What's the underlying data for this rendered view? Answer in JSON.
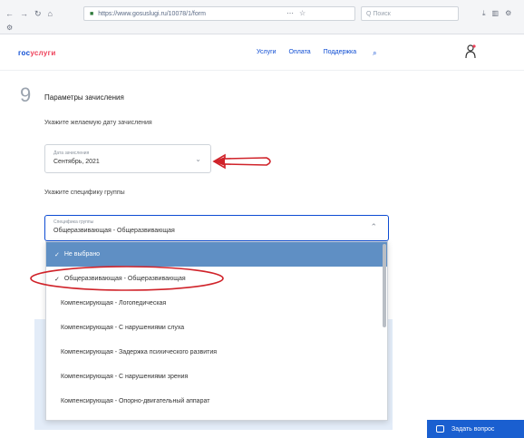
{
  "browser": {
    "nav_icons": [
      "back-icon",
      "forward-icon",
      "reload-icon",
      "home-icon"
    ],
    "url": "https://www.gosuslugi.ru/10078/1/form",
    "search_placeholder": "Q Поиск"
  },
  "header": {
    "logo_part1": "гос",
    "logo_part2": "услуги",
    "nav": [
      "Услуги",
      "Оплата",
      "Поддержка"
    ]
  },
  "step": {
    "number": "9",
    "title": "Параметры зачисления"
  },
  "date": {
    "label": "Укажите желаемую дату зачисления",
    "float_label": "Дата зачисления",
    "value": "Сентябрь, 2021"
  },
  "group": {
    "label": "Укажите специфику группы",
    "float_label": "Специфика группы",
    "value": "Общеразвивающая - Общеразвивающая"
  },
  "dropdown": {
    "items": [
      {
        "label": "Не выбрано",
        "type": "group"
      },
      {
        "label": "Общеразвивающая - Общеразвивающая",
        "type": "selected"
      },
      {
        "label": "Компенсирующая - Логопедическая",
        "type": "normal"
      },
      {
        "label": "Компенсирующая - С нарушениями слуха",
        "type": "normal"
      },
      {
        "label": "Компенсирующая - Задержка психического развития",
        "type": "normal"
      },
      {
        "label": "Компенсирующая - С нарушениями зрения",
        "type": "normal"
      },
      {
        "label": "Компенсирующая - Опорно-двигательный аппарат",
        "type": "normal"
      }
    ]
  },
  "ask_button": {
    "label": "Задать вопрос"
  },
  "colors": {
    "accent": "#0d4cd3",
    "annotation": "#d0232a",
    "group_row": "#5f8fc4"
  }
}
